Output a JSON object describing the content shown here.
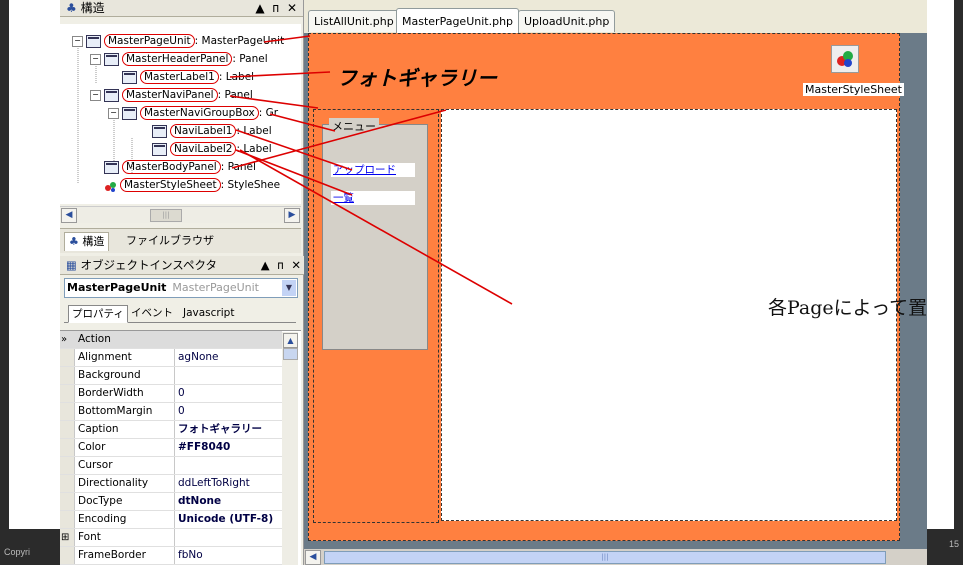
{
  "footer": {
    "left_text": "Copyri",
    "page_number": "15"
  },
  "structure_panel": {
    "title": "構造",
    "controls": "▲ ᴨ ✕",
    "tree": [
      {
        "name": "MasterPageUnit",
        "rest": ": MasterPageUnit"
      },
      {
        "name": "MasterHeaderPanel",
        "rest": ": Panel"
      },
      {
        "name": "MasterLabel1",
        "rest": ": Label"
      },
      {
        "name": "MasterNaviPanel",
        "rest": ": Panel"
      },
      {
        "name": "MasterNaviGroupBox",
        "rest": ": Gr"
      },
      {
        "name": "NaviLabel1",
        "rest": ": Label"
      },
      {
        "name": "NaviLabel2",
        "rest": ": Label"
      },
      {
        "name": "MasterBodyPanel",
        "rest": ": Panel"
      },
      {
        "name": "MasterStyleSheet",
        "rest": ": StyleShee"
      }
    ],
    "tabs": [
      "構造",
      "ファイルブラウザ"
    ]
  },
  "object_inspector": {
    "title": "オブジェクトインスペクタ",
    "controls": "▲ ᴨ ✕",
    "combo_name": "MasterPageUnit",
    "combo_type": "MasterPageUnit",
    "tabs": [
      "プロパティ",
      "イベント",
      "Javascript"
    ],
    "properties": [
      {
        "key": "Action",
        "value": ""
      },
      {
        "key": "Alignment",
        "value": "agNone"
      },
      {
        "key": "Background",
        "value": ""
      },
      {
        "key": "BorderWidth",
        "value": "0"
      },
      {
        "key": "BottomMargin",
        "value": "0"
      },
      {
        "key": "Caption",
        "value": "フォトギャラリー"
      },
      {
        "key": "Color",
        "value": "#FF8040"
      },
      {
        "key": "Cursor",
        "value": ""
      },
      {
        "key": "Directionality",
        "value": "ddLeftToRight"
      },
      {
        "key": "DocType",
        "value": "dtNone"
      },
      {
        "key": "Encoding",
        "value": "Unicode (UTF-8)"
      },
      {
        "key": "Font",
        "value": ""
      },
      {
        "key": "FrameBorder",
        "value": "fbNo"
      }
    ]
  },
  "designer": {
    "tabs": [
      "ListAllUnit.php",
      "MasterPageUnit.php",
      "UploadUnit.php"
    ],
    "header_caption": "フォトギャラリー",
    "stylesheet_label": "MasterStyleSheet",
    "group_caption": "メニュー",
    "navi_links": [
      "アップロード",
      "一覧"
    ],
    "annotation": "各Pageによって置き換えられる",
    "colors": {
      "page_color": "#FF8040",
      "annotation_line": "#DD0000"
    }
  }
}
